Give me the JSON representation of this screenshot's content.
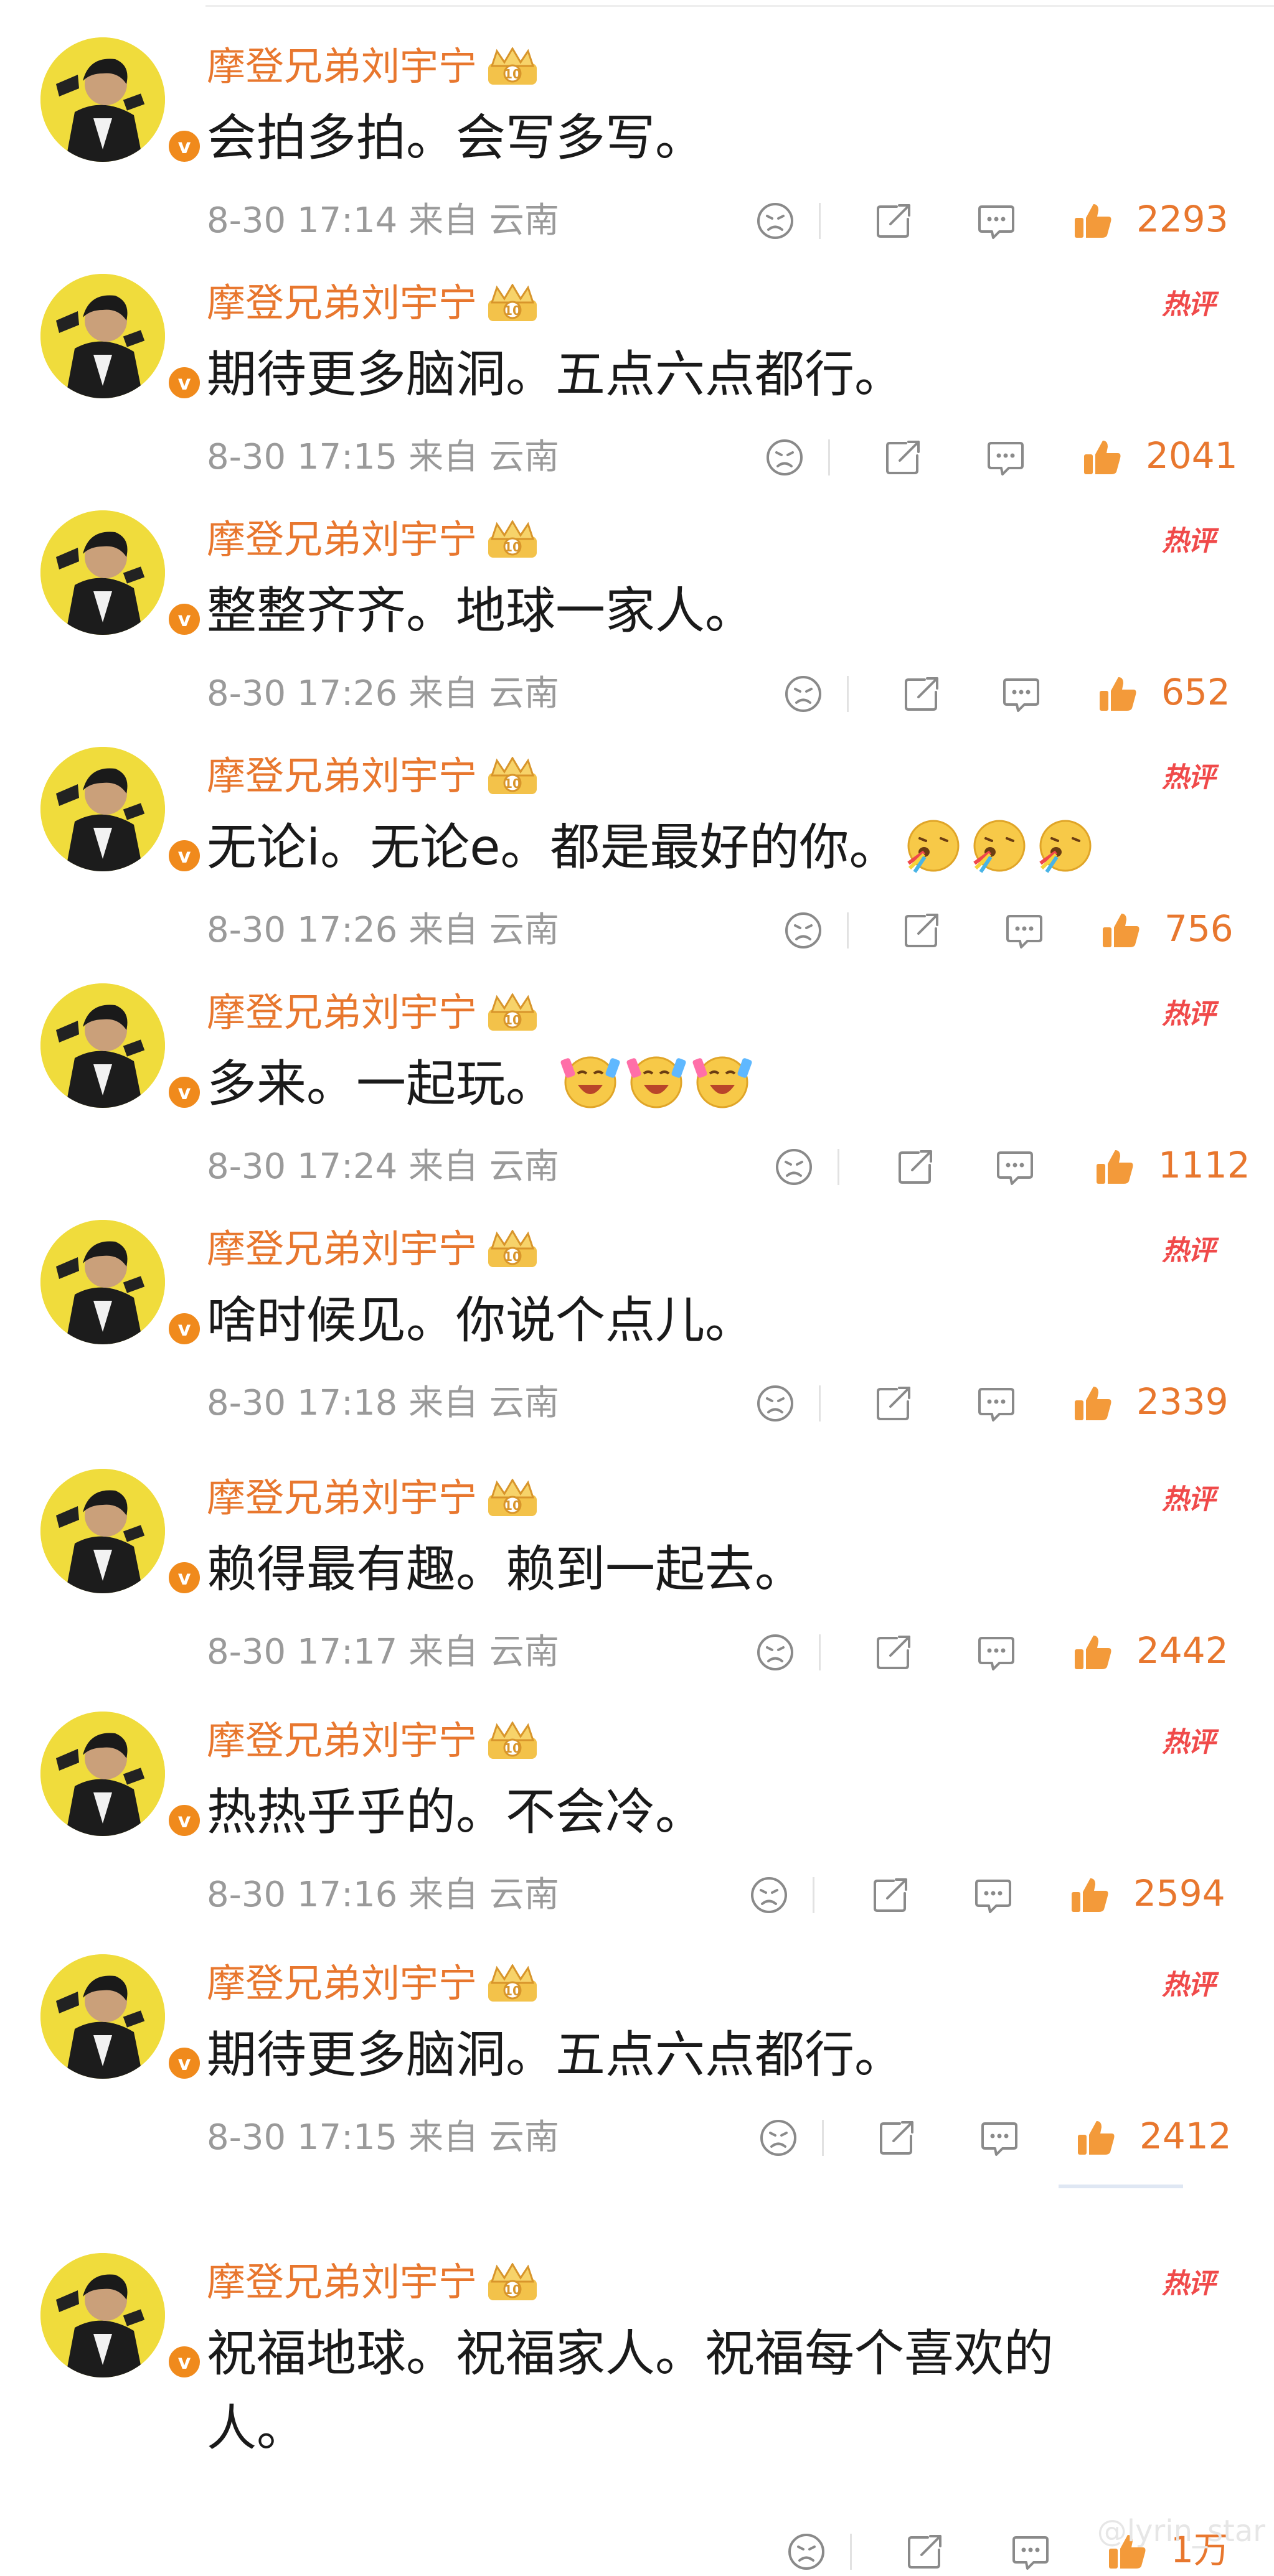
{
  "comments": [
    {
      "user": "摩登兄弟刘宇宁",
      "text": "会拍多拍。会写多写。",
      "time": "8-30 17:14",
      "location": "来自 云南",
      "likes": "2293",
      "hot_badge": ""
    },
    {
      "user": "摩登兄弟刘宇宁",
      "text": "期待更多脑洞。五点六点都行。",
      "time": "8-30 17:15",
      "location": "来自 云南",
      "likes": "2041",
      "hot_badge": "热评"
    },
    {
      "user": "摩登兄弟刘宇宁",
      "text": "整整齐齐。地球一家人。",
      "time": "8-30 17:26",
      "location": "来自 云南",
      "likes": "652",
      "hot_badge": "热评"
    },
    {
      "user": "摩登兄弟刘宇宁",
      "text": "无论i。无论e。都是最好的你。",
      "time": "8-30 17:26",
      "location": "来自 云南",
      "likes": "756",
      "hot_badge": "热评",
      "emoji": [
        "rainbow-vomit-emoji",
        "rainbow-vomit-emoji",
        "rainbow-vomit-emoji"
      ]
    },
    {
      "user": "摩登兄弟刘宇宁",
      "text": "多来。一起玩。",
      "time": "8-30 17:24",
      "location": "来自 云南",
      "likes": "1112",
      "hot_badge": "热评",
      "emoji": [
        "cheering-emoji",
        "cheering-emoji",
        "cheering-emoji"
      ]
    },
    {
      "user": "摩登兄弟刘宇宁",
      "text": "啥时候见。你说个点儿。",
      "time": "8-30 17:18",
      "location": "来自 云南",
      "likes": "2339",
      "hot_badge": "热评"
    },
    {
      "user": "摩登兄弟刘宇宁",
      "text": "赖得最有趣。赖到一起去。",
      "time": "8-30 17:17",
      "location": "来自 云南",
      "likes": "2442",
      "hot_badge": "热评"
    },
    {
      "user": "摩登兄弟刘宇宁",
      "text": "热热乎乎的。不会冷。",
      "time": "8-30 17:16",
      "location": "来自 云南",
      "likes": "2594",
      "hot_badge": "热评"
    },
    {
      "user": "摩登兄弟刘宇宁",
      "text": "期待更多脑洞。五点六点都行。",
      "time": "8-30 17:15",
      "location": "来自 云南",
      "likes": "2412",
      "hot_badge": "热评"
    },
    {
      "user": "摩登兄弟刘宇宁",
      "text": "祝福地球。祝福家人。祝福每个喜欢的人。",
      "time": "",
      "location": "",
      "likes": "1万",
      "hot_badge": "热评"
    }
  ],
  "watermark": "@lyrin_star",
  "icons": {
    "dislike": "frown-face-icon",
    "share": "share-icon",
    "comment": "comment-icon",
    "like": "thumbs-up-icon",
    "crown": "crown-badge-icon",
    "verified": "verified-v-badge"
  },
  "colors": {
    "username": "#e8772e",
    "hot_badge": "#f04a4a",
    "meta": "#9a9a9a",
    "text": "#1a1a1a",
    "verified": "#f08a1c"
  }
}
